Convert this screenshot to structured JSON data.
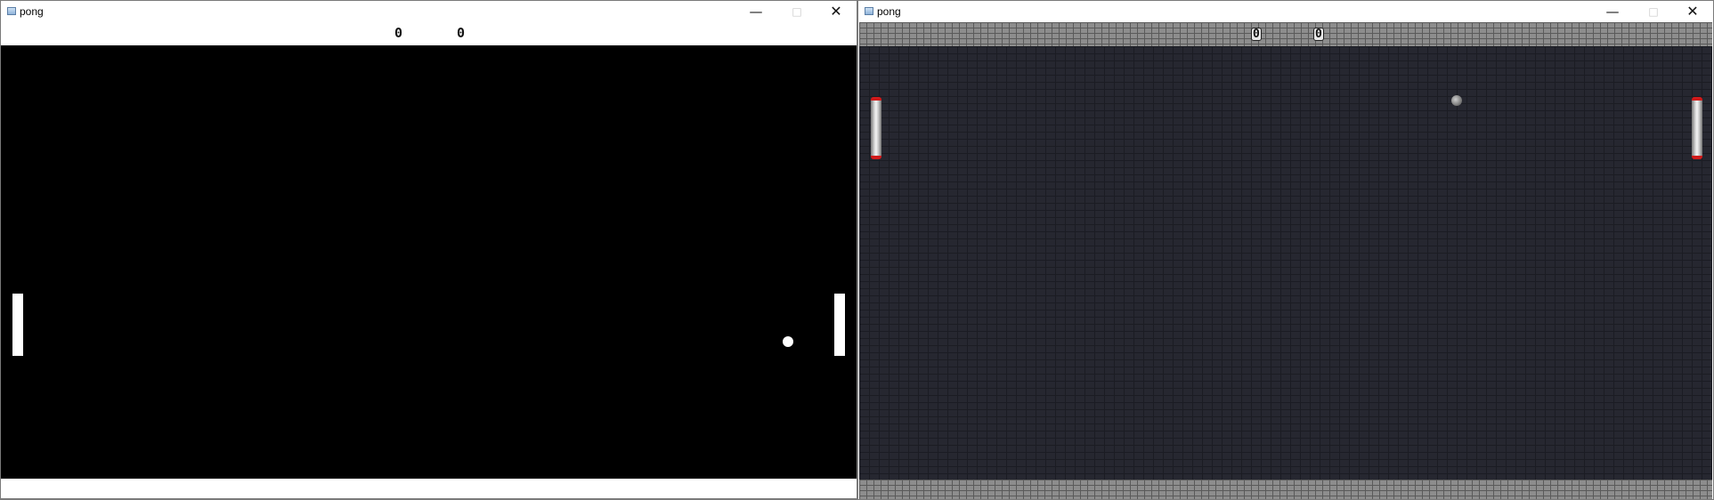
{
  "window1": {
    "title": "pong",
    "controls": {
      "minimize_icon": "minimize-icon",
      "maximize_icon": "maximize-icon",
      "close_icon": "close-icon"
    },
    "score": {
      "left": "0",
      "right": "0"
    },
    "colors": {
      "field": "#000000",
      "paddle": "#ffffff",
      "ball": "#ffffff"
    }
  },
  "window2": {
    "title": "pong",
    "controls": {
      "minimize_icon": "minimize-icon",
      "maximize_icon": "maximize-icon",
      "close_icon": "close-icon"
    },
    "score": {
      "left": "0",
      "right": "0"
    },
    "colors": {
      "field": "#262730",
      "wall": "#8d8d8d",
      "paddle_cap": "#d11a1a",
      "ball": "#7d7d7d"
    }
  }
}
